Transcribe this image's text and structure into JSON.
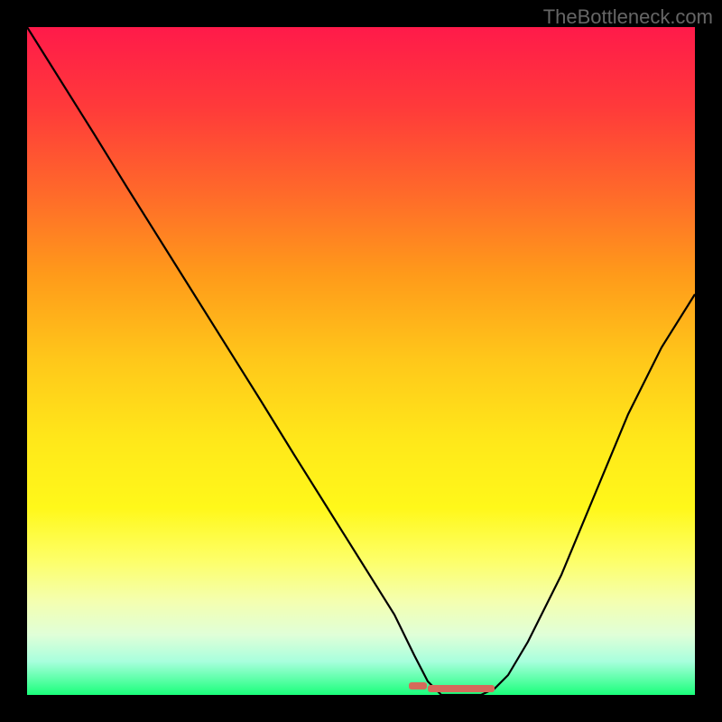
{
  "watermark": "TheBottleneck.com",
  "chart_data": {
    "type": "line",
    "title": "",
    "xlabel": "",
    "ylabel": "",
    "xlim": [
      0,
      100
    ],
    "ylim": [
      0,
      100
    ],
    "series": [
      {
        "name": "curve",
        "x": [
          0,
          5,
          10,
          15,
          20,
          25,
          30,
          35,
          40,
          45,
          50,
          55,
          58,
          60,
          62,
          64,
          66,
          68,
          70,
          72,
          75,
          80,
          85,
          90,
          95,
          100
        ],
        "y": [
          100,
          92,
          84,
          76,
          68,
          60,
          52,
          44,
          36,
          28,
          20,
          12,
          6,
          2,
          0,
          0,
          0,
          0,
          1,
          3,
          8,
          18,
          30,
          42,
          52,
          60
        ]
      }
    ],
    "markers": {
      "y": 1.5,
      "segments": [
        {
          "x_start": 58,
          "x_end": 60
        },
        {
          "x_start": 60,
          "x_end": 70
        }
      ],
      "color": "#d66a5a"
    },
    "background_gradient": {
      "top": "#ff1a4a",
      "mid": "#ffe81a",
      "bottom": "#1aff7a"
    }
  }
}
